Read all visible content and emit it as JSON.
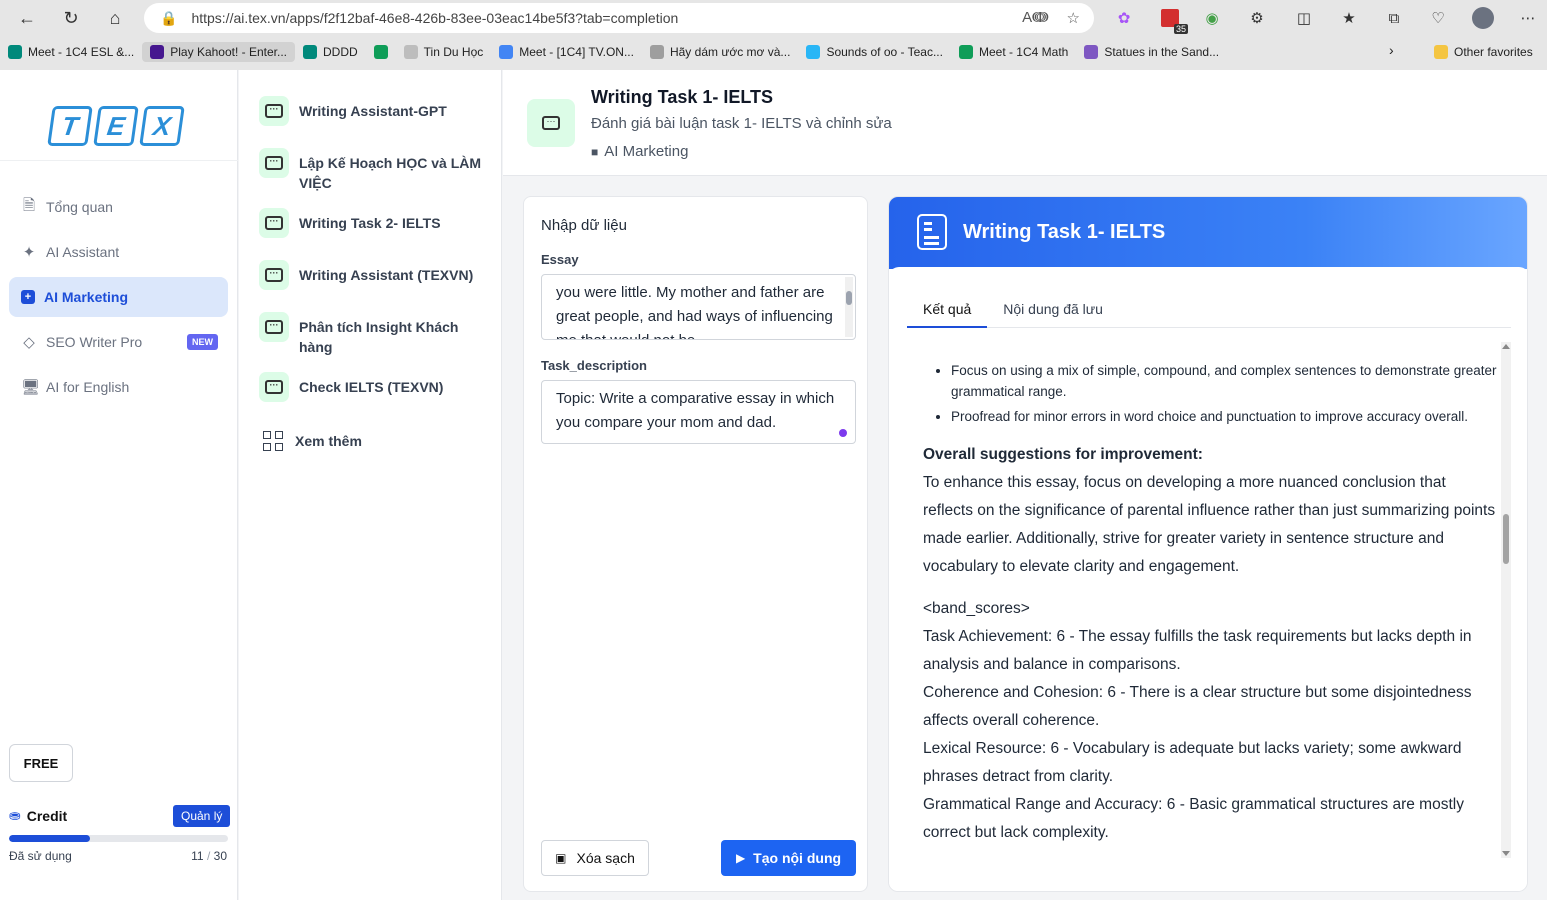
{
  "browser": {
    "url": "https://ai.tex.vn/apps/f2f12baf-46e8-426b-83ee-03eac14be5f3?tab=completion",
    "calendar_badge": "35",
    "bookmarks": [
      {
        "label": "Meet - 1C4 ESL &...",
        "color": "#00897b"
      },
      {
        "label": "Play Kahoot! - Enter...",
        "color": "#46178f"
      },
      {
        "label": "DDDD",
        "color": "#00897b"
      },
      {
        "label": "",
        "color": "#0f9d58"
      },
      {
        "label": "Tin Du Học",
        "color": "#bdbdbd"
      },
      {
        "label": "Meet - [1C4] TV.ON...",
        "color": "#4285f4"
      },
      {
        "label": "Hãy dám ước mơ và...",
        "color": "#9e9e9e"
      },
      {
        "label": "Sounds of oo - Teac...",
        "color": "#29b6f6"
      },
      {
        "label": "Meet - 1C4 Math",
        "color": "#0f9d58"
      },
      {
        "label": "Statues in the Sand...",
        "color": "#7e57c2"
      }
    ],
    "other_favorites": "Other favorites"
  },
  "sidebar": {
    "logo_letters": [
      "T",
      "E",
      "X"
    ],
    "items": [
      {
        "label": "Tổng quan",
        "icon": "document-icon"
      },
      {
        "label": "AI Assistant",
        "icon": "sparkle-icon"
      },
      {
        "label": "AI Marketing",
        "icon": "plus-square-icon"
      },
      {
        "label": "SEO Writer Pro",
        "icon": "diamond-icon",
        "badge": "NEW"
      },
      {
        "label": "AI for English",
        "icon": "monitor-icon"
      }
    ],
    "plan": "FREE",
    "credit_label": "Credit",
    "manage_label": "Quản lý",
    "used_label": "Đã sử dụng",
    "used": "11",
    "total": "30",
    "used_fraction": 0.37
  },
  "apps": {
    "items": [
      "Writing Assistant-GPT",
      "Lập Kế Hoạch HỌC và LÀM VIỆC",
      "Writing Task 2- IELTS",
      "Writing Assistant (TEXVN)",
      "Phân tích Insight Khách hàng",
      "Check IELTS (TEXVN)"
    ],
    "more_label": "Xem thêm"
  },
  "header": {
    "title": "Writing Task 1- IELTS",
    "subtitle": "Đánh giá bài luận task 1- IELTS và chỉnh sửa",
    "category": "AI Marketing"
  },
  "input": {
    "title": "Nhập dữ liệu",
    "essay_label": "Essay",
    "essay_value": "you were little. My mother and father are great people, and had ways of influencing me that would not be",
    "task_label": "Task_description",
    "task_value": "Topic: Write a comparative essay in which you compare your mom and dad.",
    "clear_label": "Xóa sạch",
    "generate_label": "Tạo nội dung"
  },
  "result": {
    "title": "Writing Task 1- IELTS",
    "tabs": [
      "Kết quả",
      "Nội dung đã lưu"
    ],
    "bullets": [
      "Focus on using a mix of simple, compound, and complex sentences to demonstrate greater grammatical range.",
      "Proofread for minor errors in word choice and punctuation to improve accuracy overall."
    ],
    "overall_heading": "Overall suggestions for improvement:",
    "overall_text": "To enhance this essay, focus on developing a more nuanced conclusion that reflects on the significance of parental influence rather than just summarizing points made earlier. Additionally, strive for greater variety in sentence structure and vocabulary to elevate clarity and engagement.",
    "band_tag": "<band_scores>",
    "scores": [
      "Task Achievement: 6 - The essay fulfills the task requirements but lacks depth in analysis and balance in comparisons.",
      "Coherence and Cohesion: 6 - There is a clear structure but some disjointedness affects overall coherence.",
      "Lexical Resource: 6 - Vocabulary is adequate but lacks variety; some awkward phrases detract from clarity.",
      "Grammatical Range and Accuracy: 6 - Basic grammatical structures are mostly correct but lack complexity."
    ]
  }
}
